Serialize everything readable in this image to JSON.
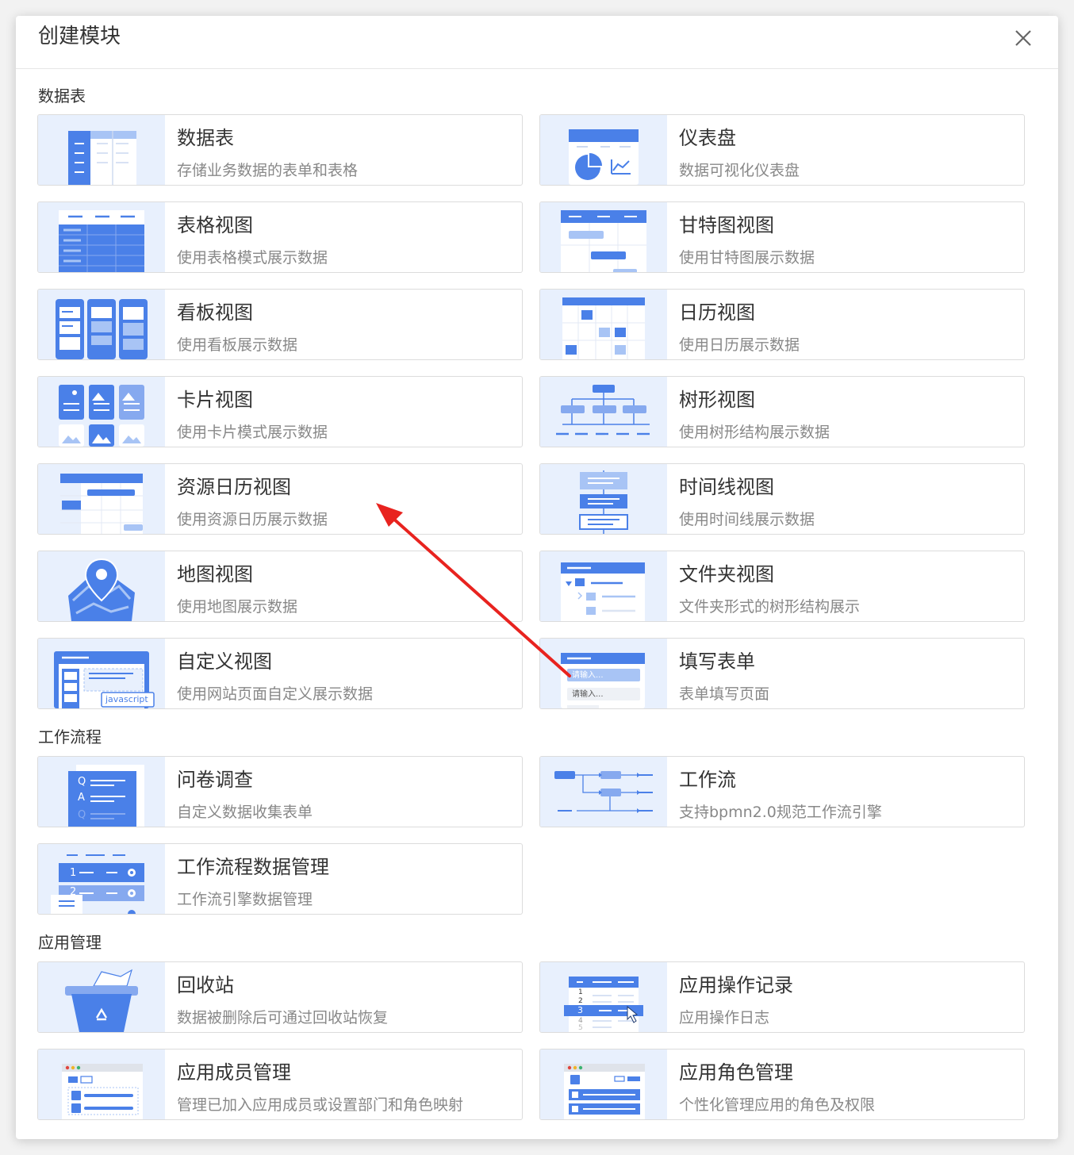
{
  "dialog": {
    "title": "创建模块",
    "close_icon": "close-icon"
  },
  "sections": {
    "data_table": {
      "title": "数据表",
      "cards": [
        {
          "name": "数据表",
          "desc": "存储业务数据的表单和表格",
          "icon": "data-table-icon"
        },
        {
          "name": "仪表盘",
          "desc": "数据可视化仪表盘",
          "icon": "dashboard-icon"
        },
        {
          "name": "表格视图",
          "desc": "使用表格模式展示数据",
          "icon": "grid-view-icon"
        },
        {
          "name": "甘特图视图",
          "desc": "使用甘特图展示数据",
          "icon": "gantt-icon"
        },
        {
          "name": "看板视图",
          "desc": "使用看板展示数据",
          "icon": "kanban-icon"
        },
        {
          "name": "日历视图",
          "desc": "使用日历展示数据",
          "icon": "calendar-icon"
        },
        {
          "name": "卡片视图",
          "desc": "使用卡片模式展示数据",
          "icon": "card-view-icon"
        },
        {
          "name": "树形视图",
          "desc": "使用树形结构展示数据",
          "icon": "tree-icon"
        },
        {
          "name": "资源日历视图",
          "desc": "使用资源日历展示数据",
          "icon": "resource-calendar-icon"
        },
        {
          "name": "时间线视图",
          "desc": "使用时间线展示数据",
          "icon": "timeline-icon"
        },
        {
          "name": "地图视图",
          "desc": "使用地图展示数据",
          "icon": "map-icon"
        },
        {
          "name": "文件夹视图",
          "desc": "文件夹形式的树形结构展示",
          "icon": "folder-icon"
        },
        {
          "name": "自定义视图",
          "desc": "使用网站页面自定义展示数据",
          "icon": "custom-view-icon",
          "badge": "javascript"
        },
        {
          "name": "填写表单",
          "desc": "表单填写页面",
          "icon": "form-icon",
          "placeholder": "请输入..."
        }
      ]
    },
    "workflow": {
      "title": "工作流程",
      "cards": [
        {
          "name": "问卷调查",
          "desc": "自定义数据收集表单",
          "icon": "survey-icon",
          "q": "Q",
          "a": "A"
        },
        {
          "name": "工作流",
          "desc": "支持bpmn2.0规范工作流引擎",
          "icon": "workflow-icon"
        },
        {
          "name": "工作流程数据管理",
          "desc": "工作流引擎数据管理",
          "icon": "workflow-data-icon",
          "n1": "1",
          "n2": "2"
        }
      ]
    },
    "app_manage": {
      "title": "应用管理",
      "cards": [
        {
          "name": "回收站",
          "desc": "数据被删除后可通过回收站恢复",
          "icon": "recycle-bin-icon"
        },
        {
          "name": "应用操作记录",
          "desc": "应用操作日志",
          "icon": "operation-log-icon",
          "rows": [
            "1",
            "2",
            "3",
            "4",
            "5"
          ]
        },
        {
          "name": "应用成员管理",
          "desc": "管理已加入应用成员或设置部门和角色映射",
          "icon": "member-manage-icon"
        },
        {
          "name": "应用角色管理",
          "desc": "个性化管理应用的角色及权限",
          "icon": "role-manage-icon"
        }
      ]
    }
  },
  "colors": {
    "accent": "#4a80e8",
    "thumb_bg": "#e8f0fd",
    "light": "#a8c4f5",
    "annotation_arrow": "#e8231f"
  }
}
